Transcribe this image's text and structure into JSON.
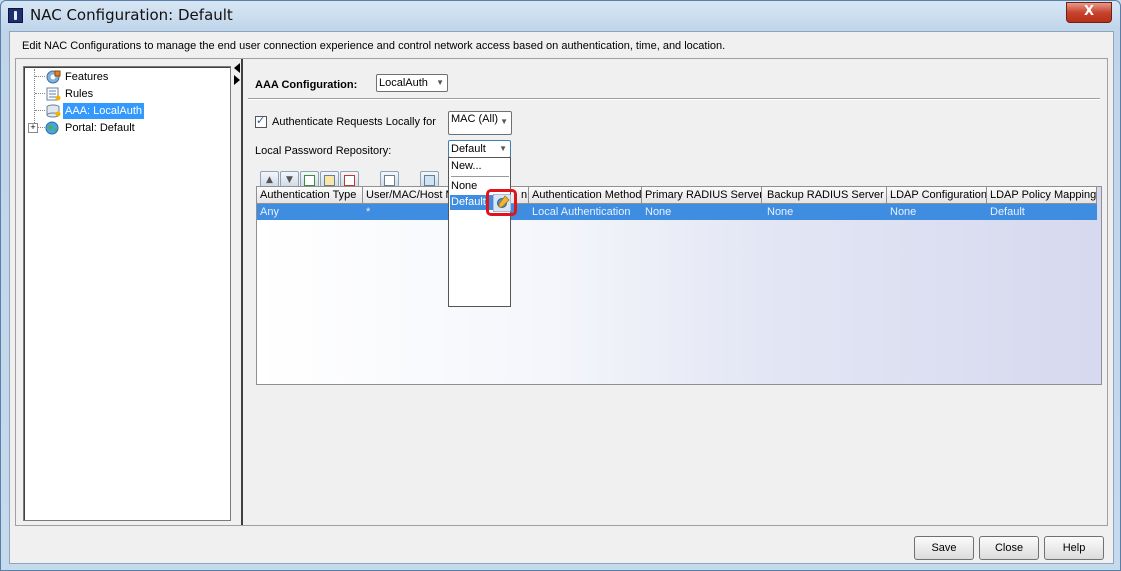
{
  "window": {
    "title": "NAC Configuration: Default",
    "close_glyph": "X"
  },
  "description": "Edit NAC Configurations to manage the end user connection experience and control network access based on authentication, time, and location.",
  "tree": {
    "items": [
      {
        "label": "Features",
        "icon": "features-icon"
      },
      {
        "label": "Rules",
        "icon": "rules-icon"
      },
      {
        "label": "AAA: LocalAuth",
        "icon": "aaa-icon",
        "selected": true
      },
      {
        "label": "Portal: Default",
        "icon": "globe-icon",
        "expander": "+"
      }
    ]
  },
  "aaa": {
    "config_label": "AAA Configuration:",
    "config_value": "LocalAuth",
    "auth_locally_label": "Authenticate Requests Locally for",
    "auth_locally_checked": true,
    "auth_locally_value": "MAC (All)",
    "repo_label": "Local Password Repository:",
    "repo_value": "Default"
  },
  "repo_dropdown": {
    "options": [
      "New...",
      "None",
      "Default"
    ],
    "selected": "Default"
  },
  "toolbar": {
    "buttons": [
      "move-up-icon",
      "move-down-icon",
      "add-row-icon",
      "edit-row-icon",
      "delete-row-icon",
      "copy-icon",
      "manage-icon"
    ]
  },
  "grid": {
    "columns": [
      "Authentication Type",
      "User/MAC/Host M",
      "Location",
      "Authentication Method",
      "Primary RADIUS Server",
      "Backup RADIUS Server",
      "LDAP Configuration",
      "LDAP Policy Mapping"
    ],
    "header_visible_fragment": "n",
    "rows": [
      [
        "Any",
        "*",
        "",
        "Local Authentication",
        "None",
        "None",
        "None",
        "Default"
      ]
    ]
  },
  "buttons": {
    "save": "Save",
    "close": "Close",
    "help": "Help"
  },
  "colors": {
    "selection": "#3f8de0",
    "highlight_box": "#e0141b",
    "tree_selection": "#3399ff"
  }
}
